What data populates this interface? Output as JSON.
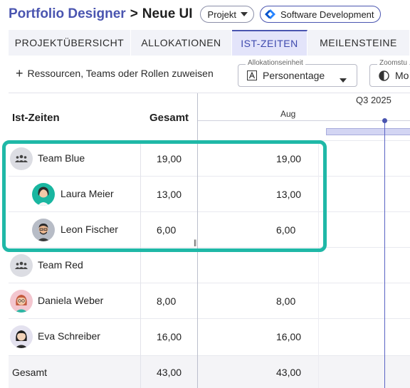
{
  "header": {
    "app_title": "Portfolio Designer",
    "separator": ">",
    "page_name": "Neue UI",
    "type_chip": "Projekt",
    "category_chip": "Software Development"
  },
  "tabs": [
    {
      "label": "PROJEKTÜBERSICHT",
      "active": false
    },
    {
      "label": "ALLOKATIONEN",
      "active": false
    },
    {
      "label": "IST-ZEITEN",
      "active": true
    },
    {
      "label": "MEILENSTEINE",
      "active": false
    }
  ],
  "toolbar": {
    "add_label": "Ressourcen, Teams oder Rollen zuweisen",
    "unit_field": {
      "label": "Allokationseinheit",
      "value": "Personentage"
    },
    "zoom_field": {
      "label": "Zoomstu",
      "value": "Mo"
    }
  },
  "grid": {
    "name_header": "Ist-Zeiten",
    "total_header": "Gesamt",
    "quarter_label": "Q3 2025",
    "month_label": "Aug",
    "rows": [
      {
        "name": "Team Blue",
        "type": "team",
        "total": "19,00",
        "aug": "19,00"
      },
      {
        "name": "Laura Meier",
        "type": "person",
        "total": "13,00",
        "aug": "13,00"
      },
      {
        "name": "Leon Fischer",
        "type": "person",
        "total": "6,00",
        "aug": "6,00"
      },
      {
        "name": "Team Red",
        "type": "team",
        "total": "",
        "aug": ""
      },
      {
        "name": "Daniela Weber",
        "type": "person",
        "total": "8,00",
        "aug": "8,00"
      },
      {
        "name": "Eva Schreiber",
        "type": "person",
        "total": "16,00",
        "aug": "16,00"
      }
    ],
    "footer": {
      "name": "Gesamt",
      "total": "43,00",
      "aug": "43,00"
    }
  },
  "colors": {
    "accent": "#4a55b0",
    "highlight": "#1fb8a7",
    "active_tab_bg": "#e3e4fa"
  }
}
